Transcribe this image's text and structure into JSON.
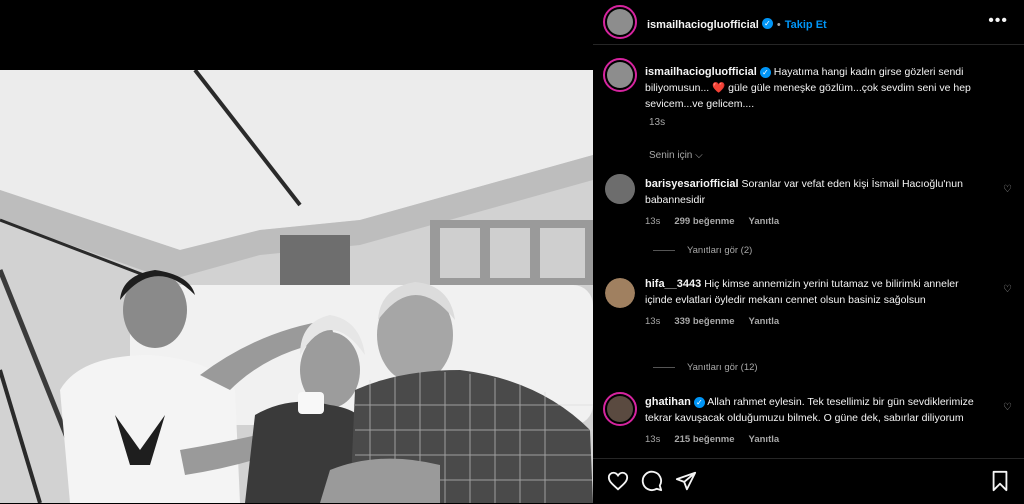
{
  "post": {
    "username": "ismailhaciogluofficial",
    "follow_label": "Takip Et",
    "more_label": "•••",
    "caption": "Hayatıma hangi kadın girse gözleri sendi biliyomusun... ❤️ güle güle meneşke gözlüm...çok sevdim seni ve hep sevicem...ve gelicem....",
    "caption_time": "13s",
    "for_you_label": "Senin için"
  },
  "comments": [
    {
      "username": "barisyesariofficial",
      "text": "Soranlar var vefat eden kişi İsmail Hacıoğlu'nun babannesidir",
      "time": "13s",
      "likes": "299 beğenme",
      "reply_label": "Yanıtla",
      "view_replies": "Yanıtları gör (2)"
    },
    {
      "username": "hifa__3443",
      "text": "Hiç kimse annemizin yerini tutamaz ve bilirimki anneler içinde evlatlari öyledir mekanı cennet olsun basiniz sağolsun",
      "time": "13s",
      "likes": "339 beğenme",
      "reply_label": "Yanıtla",
      "view_replies": "Yanıtları gör (12)"
    },
    {
      "username": "ghatihan",
      "text": "Allah rahmet eylesin. Tek tesellimiz bir gün sevdiklerimize tekrar kavuşacak olduğumuzu bilmek. O güne dek, sabırlar diliyorum",
      "time": "13s",
      "likes": "215 beğenme",
      "reply_label": "Yanıtla"
    }
  ],
  "icons": {
    "like": "heart-icon",
    "comment": "comment-icon",
    "share": "send-icon",
    "save": "bookmark-icon"
  },
  "colors": {
    "accent": "#0095f6",
    "background": "#000000",
    "muted": "#a8a8a8",
    "like_heart": "#ff3040"
  }
}
